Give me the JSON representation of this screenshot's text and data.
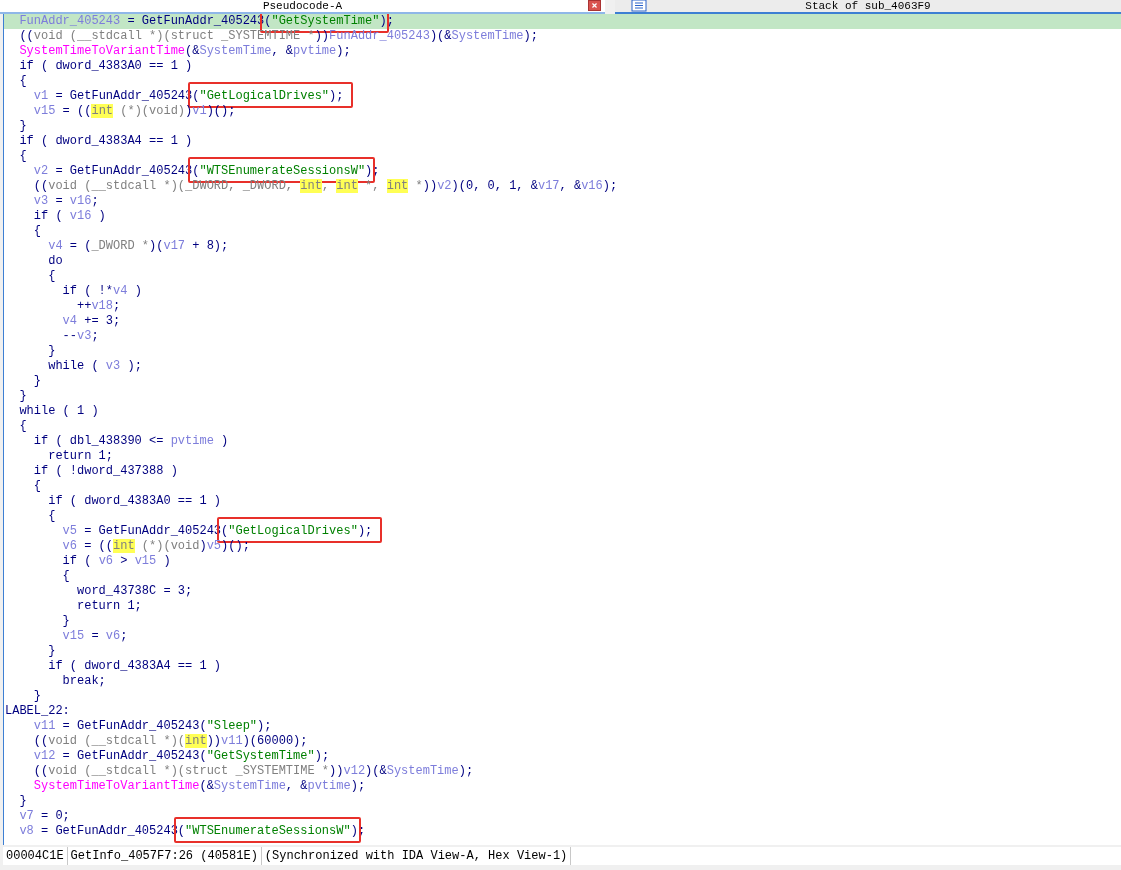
{
  "tabs": [
    {
      "label": "Pseudocode-A",
      "selected": true,
      "closable": true
    },
    {
      "label": "Stack of sub_4063F9",
      "selected": false,
      "closable": false
    }
  ],
  "code_lines": [
    {
      "selected": true,
      "tokens": [
        {
          "kind": "var",
          "text": "  FunAddr_405243"
        },
        {
          "kind": "plain",
          "text": " = GetFunAddr_405243"
        },
        {
          "kind": "plain",
          "text": "(",
          "boxed": true
        },
        {
          "kind": "string",
          "text": "\"GetSystemTime\"",
          "boxed": true
        },
        {
          "kind": "plain",
          "text": ");"
        }
      ]
    },
    {
      "selected": false,
      "tokens": [
        {
          "kind": "plain",
          "text": "  (("
        },
        {
          "kind": "cast",
          "text": "void (__stdcall *)(struct _SYSTEMTIME *"
        },
        {
          "kind": "plain",
          "text": "))"
        },
        {
          "kind": "var",
          "text": "FunAddr_405243"
        },
        {
          "kind": "plain",
          "text": ")(&"
        },
        {
          "kind": "var",
          "text": "SystemTime"
        },
        {
          "kind": "plain",
          "text": ");"
        }
      ]
    },
    {
      "selected": false,
      "tokens": [
        {
          "kind": "api",
          "text": "  SystemTimeToVariantTime"
        },
        {
          "kind": "plain",
          "text": "(&"
        },
        {
          "kind": "var",
          "text": "SystemTime"
        },
        {
          "kind": "plain",
          "text": ", &"
        },
        {
          "kind": "var",
          "text": "pvtime"
        },
        {
          "kind": "plain",
          "text": ");"
        }
      ]
    },
    {
      "selected": false,
      "tokens": [
        {
          "kind": "plain",
          "text": "  if ( dword_4383A0 == 1 )"
        }
      ]
    },
    {
      "selected": false,
      "tokens": [
        {
          "kind": "plain",
          "text": "  {"
        }
      ]
    },
    {
      "selected": false,
      "tokens": [
        {
          "kind": "var",
          "text": "    v1"
        },
        {
          "kind": "plain",
          "text": " = GetFunAddr_405243"
        },
        {
          "kind": "plain",
          "text": "(",
          "boxed": true
        },
        {
          "kind": "string",
          "text": "\"GetLogicalDrives\"",
          "boxed": true
        },
        {
          "kind": "plain",
          "text": ");",
          "boxed": true
        }
      ]
    },
    {
      "selected": false,
      "tokens": [
        {
          "kind": "var",
          "text": "    v15"
        },
        {
          "kind": "plain",
          "text": " = (("
        },
        {
          "kind": "type",
          "text": "int"
        },
        {
          "kind": "cast",
          "text": " (*)(void)"
        },
        {
          "kind": "plain",
          "text": ")"
        },
        {
          "kind": "var",
          "text": "v1"
        },
        {
          "kind": "plain",
          "text": ")();"
        }
      ]
    },
    {
      "selected": false,
      "tokens": [
        {
          "kind": "plain",
          "text": "  }"
        }
      ]
    },
    {
      "selected": false,
      "tokens": [
        {
          "kind": "plain",
          "text": "  if ( dword_4383A4 == 1 )"
        }
      ]
    },
    {
      "selected": false,
      "tokens": [
        {
          "kind": "plain",
          "text": "  {"
        }
      ]
    },
    {
      "selected": false,
      "tokens": [
        {
          "kind": "var",
          "text": "    v2"
        },
        {
          "kind": "plain",
          "text": " = GetFunAddr_405243"
        },
        {
          "kind": "plain",
          "text": "(",
          "boxed": true
        },
        {
          "kind": "string",
          "text": "\"WTSEnumerateSessionsW\"",
          "boxed": true
        },
        {
          "kind": "plain",
          "text": ");"
        }
      ]
    },
    {
      "selected": false,
      "tokens": [
        {
          "kind": "plain",
          "text": "    (("
        },
        {
          "kind": "cast",
          "text": "void (__stdcall *)(_DWORD, _DWORD, "
        },
        {
          "kind": "type",
          "text": "int"
        },
        {
          "kind": "cast",
          "text": ", "
        },
        {
          "kind": "type",
          "text": "int"
        },
        {
          "kind": "cast",
          "text": " *, "
        },
        {
          "kind": "type",
          "text": "int"
        },
        {
          "kind": "cast",
          "text": " *"
        },
        {
          "kind": "plain",
          "text": "))"
        },
        {
          "kind": "var",
          "text": "v2"
        },
        {
          "kind": "plain",
          "text": ")(0, 0, 1, &"
        },
        {
          "kind": "var",
          "text": "v17"
        },
        {
          "kind": "plain",
          "text": ", &"
        },
        {
          "kind": "var",
          "text": "v16"
        },
        {
          "kind": "plain",
          "text": ");"
        }
      ]
    },
    {
      "selected": false,
      "tokens": [
        {
          "kind": "var",
          "text": "    v3"
        },
        {
          "kind": "plain",
          "text": " = "
        },
        {
          "kind": "var",
          "text": "v16"
        },
        {
          "kind": "plain",
          "text": ";"
        }
      ]
    },
    {
      "selected": false,
      "tokens": [
        {
          "kind": "plain",
          "text": "    if ( "
        },
        {
          "kind": "var",
          "text": "v16"
        },
        {
          "kind": "plain",
          "text": " )"
        }
      ]
    },
    {
      "selected": false,
      "tokens": [
        {
          "kind": "plain",
          "text": "    {"
        }
      ]
    },
    {
      "selected": false,
      "tokens": [
        {
          "kind": "var",
          "text": "      v4"
        },
        {
          "kind": "plain",
          "text": " = ("
        },
        {
          "kind": "cast",
          "text": "_DWORD *"
        },
        {
          "kind": "plain",
          "text": ")("
        },
        {
          "kind": "var",
          "text": "v17"
        },
        {
          "kind": "plain",
          "text": " + 8);"
        }
      ]
    },
    {
      "selected": false,
      "tokens": [
        {
          "kind": "plain",
          "text": "      do"
        }
      ]
    },
    {
      "selected": false,
      "tokens": [
        {
          "kind": "plain",
          "text": "      {"
        }
      ]
    },
    {
      "selected": false,
      "tokens": [
        {
          "kind": "plain",
          "text": "        if ( !*"
        },
        {
          "kind": "var",
          "text": "v4"
        },
        {
          "kind": "plain",
          "text": " )"
        }
      ]
    },
    {
      "selected": false,
      "tokens": [
        {
          "kind": "plain",
          "text": "          ++"
        },
        {
          "kind": "var",
          "text": "v18"
        },
        {
          "kind": "plain",
          "text": ";"
        }
      ]
    },
    {
      "selected": false,
      "tokens": [
        {
          "kind": "var",
          "text": "        v4"
        },
        {
          "kind": "plain",
          "text": " += 3;"
        }
      ]
    },
    {
      "selected": false,
      "tokens": [
        {
          "kind": "plain",
          "text": "        --"
        },
        {
          "kind": "var",
          "text": "v3"
        },
        {
          "kind": "plain",
          "text": ";"
        }
      ]
    },
    {
      "selected": false,
      "tokens": [
        {
          "kind": "plain",
          "text": "      }"
        }
      ]
    },
    {
      "selected": false,
      "tokens": [
        {
          "kind": "plain",
          "text": "      while ( "
        },
        {
          "kind": "var",
          "text": "v3"
        },
        {
          "kind": "plain",
          "text": " );"
        }
      ]
    },
    {
      "selected": false,
      "tokens": [
        {
          "kind": "plain",
          "text": "    }"
        }
      ]
    },
    {
      "selected": false,
      "tokens": [
        {
          "kind": "plain",
          "text": "  }"
        }
      ]
    },
    {
      "selected": false,
      "tokens": [
        {
          "kind": "plain",
          "text": "  while ( 1 )"
        }
      ]
    },
    {
      "selected": false,
      "tokens": [
        {
          "kind": "plain",
          "text": "  {"
        }
      ]
    },
    {
      "selected": false,
      "tokens": [
        {
          "kind": "plain",
          "text": "    if ( dbl_438390 <= "
        },
        {
          "kind": "var",
          "text": "pvtime"
        },
        {
          "kind": "plain",
          "text": " )"
        }
      ]
    },
    {
      "selected": false,
      "tokens": [
        {
          "kind": "plain",
          "text": "      return 1;"
        }
      ]
    },
    {
      "selected": false,
      "tokens": [
        {
          "kind": "plain",
          "text": "    if ( !dword_437388 )"
        }
      ]
    },
    {
      "selected": false,
      "tokens": [
        {
          "kind": "plain",
          "text": "    {"
        }
      ]
    },
    {
      "selected": false,
      "tokens": [
        {
          "kind": "plain",
          "text": "      if ( dword_4383A0 == 1 )"
        }
      ]
    },
    {
      "selected": false,
      "tokens": [
        {
          "kind": "plain",
          "text": "      {"
        }
      ]
    },
    {
      "selected": false,
      "tokens": [
        {
          "kind": "var",
          "text": "        v5"
        },
        {
          "kind": "plain",
          "text": " = GetFunAddr_405243"
        },
        {
          "kind": "plain",
          "text": "(",
          "boxed": true
        },
        {
          "kind": "string",
          "text": "\"GetLogicalDrives\"",
          "boxed": true
        },
        {
          "kind": "plain",
          "text": ");",
          "boxed": true
        }
      ]
    },
    {
      "selected": false,
      "tokens": [
        {
          "kind": "var",
          "text": "        v6"
        },
        {
          "kind": "plain",
          "text": " = (("
        },
        {
          "kind": "type",
          "text": "int"
        },
        {
          "kind": "cast",
          "text": " (*)(void"
        },
        {
          "kind": "plain",
          "text": ")"
        },
        {
          "kind": "var",
          "text": "v5"
        },
        {
          "kind": "plain",
          "text": ")();"
        }
      ]
    },
    {
      "selected": false,
      "tokens": [
        {
          "kind": "plain",
          "text": "        if ( "
        },
        {
          "kind": "var",
          "text": "v6"
        },
        {
          "kind": "plain",
          "text": " > "
        },
        {
          "kind": "var",
          "text": "v15"
        },
        {
          "kind": "plain",
          "text": " )"
        }
      ]
    },
    {
      "selected": false,
      "tokens": [
        {
          "kind": "plain",
          "text": "        {"
        }
      ]
    },
    {
      "selected": false,
      "tokens": [
        {
          "kind": "plain",
          "text": "          word_43738C = 3;"
        }
      ]
    },
    {
      "selected": false,
      "tokens": [
        {
          "kind": "plain",
          "text": "          return 1;"
        }
      ]
    },
    {
      "selected": false,
      "tokens": [
        {
          "kind": "plain",
          "text": "        }"
        }
      ]
    },
    {
      "selected": false,
      "tokens": [
        {
          "kind": "var",
          "text": "        v15"
        },
        {
          "kind": "plain",
          "text": " = "
        },
        {
          "kind": "var",
          "text": "v6"
        },
        {
          "kind": "plain",
          "text": ";"
        }
      ]
    },
    {
      "selected": false,
      "tokens": [
        {
          "kind": "plain",
          "text": "      }"
        }
      ]
    },
    {
      "selected": false,
      "tokens": [
        {
          "kind": "plain",
          "text": "      if ( dword_4383A4 == 1 )"
        }
      ]
    },
    {
      "selected": false,
      "tokens": [
        {
          "kind": "plain",
          "text": "        break;"
        }
      ]
    },
    {
      "selected": false,
      "tokens": [
        {
          "kind": "plain",
          "text": "    }"
        }
      ]
    },
    {
      "selected": false,
      "tokens": [
        {
          "kind": "plain",
          "text": "LABEL_22:"
        }
      ]
    },
    {
      "selected": false,
      "tokens": [
        {
          "kind": "var",
          "text": "    v11"
        },
        {
          "kind": "plain",
          "text": " = GetFunAddr_405243("
        },
        {
          "kind": "string",
          "text": "\"Sleep\""
        },
        {
          "kind": "plain",
          "text": ");"
        }
      ]
    },
    {
      "selected": false,
      "tokens": [
        {
          "kind": "plain",
          "text": "    (("
        },
        {
          "kind": "cast",
          "text": "void (__stdcall *)("
        },
        {
          "kind": "type",
          "text": "int"
        },
        {
          "kind": "plain",
          "text": "))"
        },
        {
          "kind": "var",
          "text": "v11"
        },
        {
          "kind": "plain",
          "text": ")(60000);"
        }
      ]
    },
    {
      "selected": false,
      "tokens": [
        {
          "kind": "var",
          "text": "    v12"
        },
        {
          "kind": "plain",
          "text": " = GetFunAddr_405243("
        },
        {
          "kind": "string",
          "text": "\"GetSystemTime\""
        },
        {
          "kind": "plain",
          "text": ");"
        }
      ]
    },
    {
      "selected": false,
      "tokens": [
        {
          "kind": "plain",
          "text": "    (("
        },
        {
          "kind": "cast",
          "text": "void (__stdcall *)(struct _SYSTEMTIME *"
        },
        {
          "kind": "plain",
          "text": "))"
        },
        {
          "kind": "var",
          "text": "v12"
        },
        {
          "kind": "plain",
          "text": ")(&"
        },
        {
          "kind": "var",
          "text": "SystemTime"
        },
        {
          "kind": "plain",
          "text": ");"
        }
      ]
    },
    {
      "selected": false,
      "tokens": [
        {
          "kind": "api",
          "text": "    SystemTimeToVariantTime"
        },
        {
          "kind": "plain",
          "text": "(&"
        },
        {
          "kind": "var",
          "text": "SystemTime"
        },
        {
          "kind": "plain",
          "text": ", &"
        },
        {
          "kind": "var",
          "text": "pvtime"
        },
        {
          "kind": "plain",
          "text": ");"
        }
      ]
    },
    {
      "selected": false,
      "tokens": [
        {
          "kind": "plain",
          "text": "  }"
        }
      ]
    },
    {
      "selected": false,
      "tokens": [
        {
          "kind": "var",
          "text": "  v7"
        },
        {
          "kind": "plain",
          "text": " = 0;"
        }
      ]
    },
    {
      "selected": false,
      "tokens": [
        {
          "kind": "var",
          "text": "  v8"
        },
        {
          "kind": "plain",
          "text": " = GetFunAddr_405243"
        },
        {
          "kind": "plain",
          "text": "(",
          "boxed": true
        },
        {
          "kind": "string",
          "text": "\"WTSEnumerateSessionsW\"",
          "boxed": true
        },
        {
          "kind": "plain",
          "text": ");"
        }
      ]
    }
  ],
  "status_bar": [
    "00004C1E",
    "GetInfo_4057F7:26 (40581E)",
    "(Synchronized with IDA View-A, Hex View-1)"
  ]
}
